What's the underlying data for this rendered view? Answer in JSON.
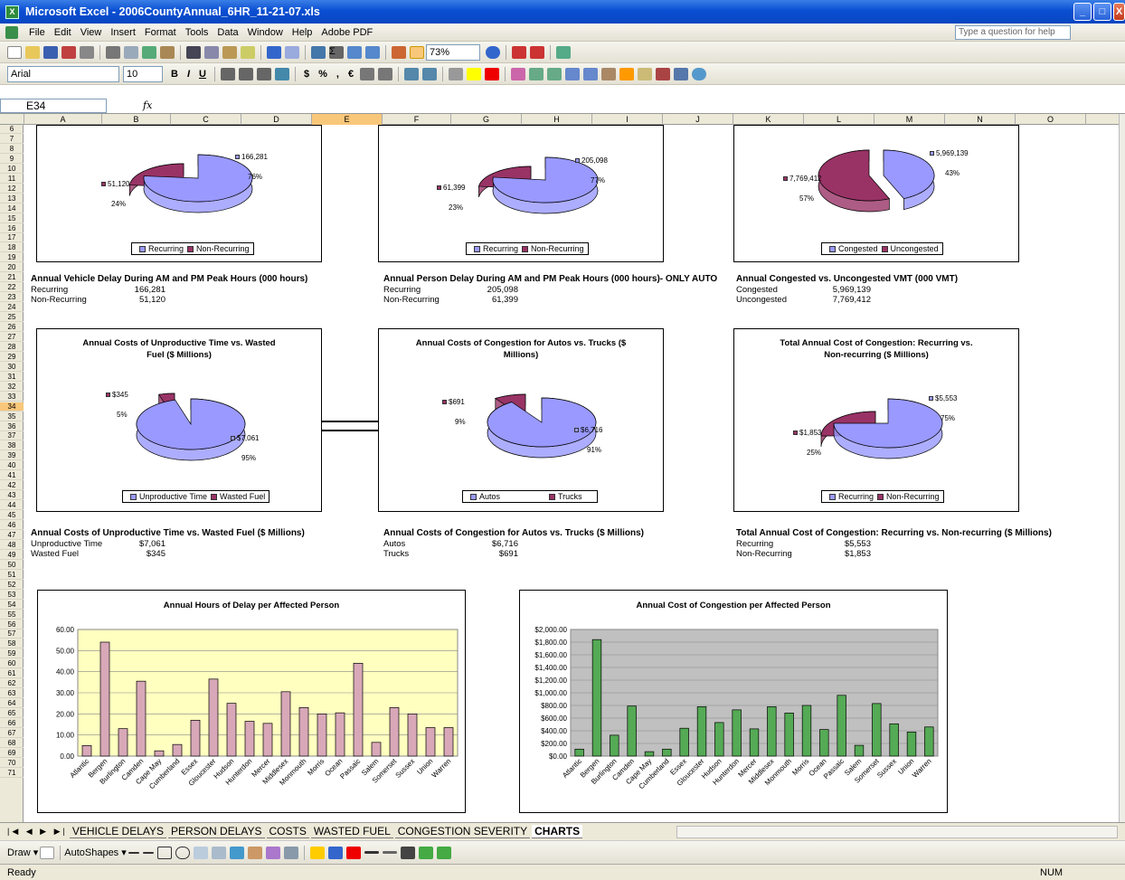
{
  "window": {
    "title": "Microsoft Excel - 2006CountyAnnual_6HR_11-21-07.xls",
    "controls": [
      "_",
      "□",
      "X"
    ]
  },
  "menu": {
    "items": [
      "File",
      "Edit",
      "View",
      "Insert",
      "Format",
      "Tools",
      "Data",
      "Window",
      "Help",
      "Adobe PDF"
    ],
    "help_placeholder": "Type a question for help"
  },
  "toolbar": {
    "zoom": "73%",
    "font": "Arial",
    "font_size": "10",
    "bold": "B",
    "italic": "I",
    "underline": "U",
    "currency": "$",
    "percent": "%",
    "comma": ",",
    "euro": "€"
  },
  "formula_bar": {
    "name_box": "E34",
    "fx": "fx",
    "value": ""
  },
  "columns": [
    "A",
    "B",
    "C",
    "D",
    "E",
    "F",
    "G",
    "H",
    "I",
    "J",
    "K",
    "L",
    "M",
    "N",
    "O"
  ],
  "selected_column": "E",
  "rows": [
    "6",
    "7",
    "8",
    "9",
    "10",
    "11",
    "12",
    "13",
    "14",
    "15",
    "16",
    "17",
    "18",
    "19",
    "20",
    "21",
    "22",
    "23",
    "24",
    "25",
    "26",
    "27",
    "28",
    "29",
    "30",
    "31",
    "32",
    "33",
    "34",
    "35",
    "36",
    "37",
    "38",
    "39",
    "40",
    "41",
    "42",
    "43",
    "44",
    "45",
    "46",
    "47",
    "48",
    "49",
    "50",
    "51",
    "52",
    "53",
    "54",
    "55",
    "56",
    "57",
    "58",
    "59",
    "60",
    "61",
    "62",
    "63",
    "64",
    "65",
    "66",
    "67",
    "68",
    "69",
    "70",
    "71"
  ],
  "selected_row": "34",
  "colors": {
    "pie_main": "#9999ff",
    "pie_other": "#993366",
    "bar_pink": "#d8a8b8",
    "bar_green": "#55aa55",
    "chart_bg_yellow": "#ffffc0",
    "chart_bg_gray": "#c0c0c0"
  },
  "tables": {
    "vehicle_delay": {
      "title": "Annual Vehicle Delay During AM and PM Peak Hours (000 hours)",
      "rows": [
        [
          "Recurring",
          "166,281"
        ],
        [
          "Non-Recurring",
          "51,120"
        ]
      ]
    },
    "person_delay": {
      "title": "Annual Person Delay During AM and PM Peak Hours (000 hours)- ONLY AUTO",
      "rows": [
        [
          "Recurring",
          "205,098"
        ],
        [
          "Non-Recurring",
          "61,399"
        ]
      ]
    },
    "vmt": {
      "title": "Annual Congested vs. Uncongested VMT (000 VMT)",
      "rows": [
        [
          "Congested",
          "5,969,139"
        ],
        [
          "Uncongested",
          "7,769,412"
        ]
      ]
    },
    "fuel": {
      "title": "Annual Costs of Unproductive Time vs. Wasted Fuel ($ Millions)",
      "rows": [
        [
          "Unproductive Time",
          "$7,061"
        ],
        [
          "Wasted Fuel",
          "$345"
        ]
      ]
    },
    "autos_trucks": {
      "title": "Annual Costs of Congestion for Autos vs. Trucks ($ Millions)",
      "rows": [
        [
          "Autos",
          "$6,716"
        ],
        [
          "Trucks",
          "$691"
        ]
      ]
    },
    "total_cost": {
      "title": "Total Annual Cost of Congestion: Recurring vs. Non-recurring ($ Millions)",
      "rows": [
        [
          "Recurring",
          "$5,553"
        ],
        [
          "Non-Recurring",
          "$1,853"
        ]
      ]
    }
  },
  "chart_data": [
    {
      "type": "pie",
      "title": "",
      "labels": [
        "Recurring",
        "Non-Recurring"
      ],
      "values": [
        166281,
        51120
      ],
      "value_labels": [
        "166,281",
        "51,120"
      ],
      "percent_labels": [
        "76%",
        "24%"
      ]
    },
    {
      "type": "pie",
      "title": "",
      "labels": [
        "Recurring",
        "Non-Recurring"
      ],
      "values": [
        205098,
        61399
      ],
      "value_labels": [
        "205,098",
        "61,399"
      ],
      "percent_labels": [
        "77%",
        "23%"
      ]
    },
    {
      "type": "pie",
      "title": "",
      "labels": [
        "Congested",
        "Uncongested"
      ],
      "values": [
        5969139,
        7769412
      ],
      "value_labels": [
        "5,969,139",
        "7,769,412"
      ],
      "percent_labels": [
        "43%",
        "57%"
      ]
    },
    {
      "type": "pie",
      "title": "Annual Costs of Unproductive Time vs. Wasted Fuel ($ Millions)",
      "labels": [
        "Unproductive Time",
        "Wasted Fuel"
      ],
      "values": [
        7061,
        345
      ],
      "value_labels": [
        "$7,061",
        "$345"
      ],
      "percent_labels": [
        "95%",
        "5%"
      ]
    },
    {
      "type": "pie",
      "title": "Annual Costs of Congestion for Autos vs. Trucks ($ Millions)",
      "labels": [
        "Autos",
        "Trucks"
      ],
      "values": [
        6716,
        691
      ],
      "value_labels": [
        "$6,716",
        "$691"
      ],
      "percent_labels": [
        "91%",
        "9%"
      ]
    },
    {
      "type": "pie",
      "title": "Total Annual Cost of Congestion: Recurring vs. Non-recurring ($ Millions)",
      "labels": [
        "Recurring",
        "Non-Recurring"
      ],
      "values": [
        5553,
        1853
      ],
      "value_labels": [
        "$5,553",
        "$1,853"
      ],
      "percent_labels": [
        "75%",
        "25%"
      ]
    },
    {
      "type": "bar",
      "title": "Annual Hours of Delay per Affected Person",
      "categories": [
        "Atlantic",
        "Bergen",
        "Burlington",
        "Camden",
        "Cape May",
        "Cumberland",
        "Essex",
        "Gloucester",
        "Hudson",
        "Hunterdon",
        "Mercer",
        "Middlesex",
        "Monmouth",
        "Morris",
        "Ocean",
        "Passaic",
        "Salem",
        "Somerset",
        "Sussex",
        "Union",
        "Warren"
      ],
      "values": [
        5,
        54,
        13,
        35.5,
        2.5,
        5.5,
        17,
        36.5,
        25,
        16.5,
        15.5,
        30.5,
        23,
        20,
        20.5,
        44,
        6.5,
        23,
        20,
        13.5,
        13.5
      ],
      "ylim": [
        0,
        60
      ],
      "yticks": [
        "0.00",
        "10.00",
        "20.00",
        "30.00",
        "40.00",
        "50.00",
        "60.00"
      ],
      "grid": true
    },
    {
      "type": "bar",
      "title": "Annual Cost of Congestion per Affected Person",
      "categories": [
        "Atlantic",
        "Bergen",
        "Burlington",
        "Camden",
        "Cape May",
        "Cumberland",
        "Essex",
        "Gloucester",
        "Hudson",
        "Hunterdon",
        "Mercer",
        "Middlesex",
        "Monmouth",
        "Morris",
        "Ocean",
        "Passaic",
        "Salem",
        "Somerset",
        "Sussex",
        "Union",
        "Warren"
      ],
      "values": [
        110,
        1840,
        330,
        790,
        70,
        110,
        440,
        780,
        530,
        730,
        430,
        780,
        680,
        800,
        420,
        960,
        170,
        830,
        510,
        380,
        460
      ],
      "ylim": [
        0,
        2000
      ],
      "yticks": [
        "$0.00",
        "$200.00",
        "$400.00",
        "$600.00",
        "$800.00",
        "$1,000.00",
        "$1,200.00",
        "$1,400.00",
        "$1,600.00",
        "$1,800.00",
        "$2,000.00"
      ],
      "grid": true
    }
  ],
  "sheet_tabs": [
    "VEHICLE DELAYS",
    "PERSON DELAYS",
    "COSTS",
    "WASTED FUEL",
    "CONGESTION SEVERITY",
    "CHARTS"
  ],
  "active_tab": "CHARTS",
  "drawing": {
    "draw": "Draw ▾",
    "autoshapes": "AutoShapes ▾"
  },
  "status": {
    "left": "Ready",
    "right": "NUM"
  }
}
